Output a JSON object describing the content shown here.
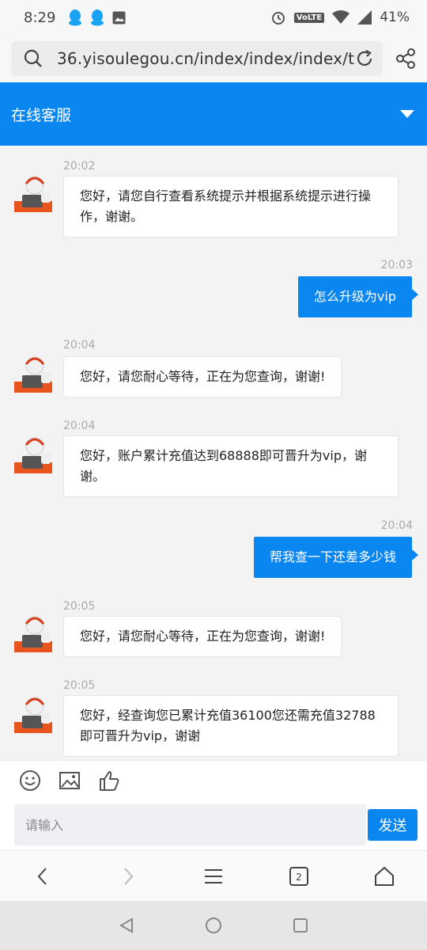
{
  "status": {
    "time": "8:29",
    "network": "VoLTE",
    "battery": "41%"
  },
  "browser": {
    "url": "36.yisoulegou.cn/index/index/index/t",
    "tab_count": "2"
  },
  "header": {
    "title": "在线客服"
  },
  "messages": [
    {
      "side": "in",
      "time": "20:02",
      "text": "您好，请您自行查看系统提示并根据系统提示进行操作，谢谢。"
    },
    {
      "side": "out",
      "time": "20:03",
      "text": "怎么升级为vip"
    },
    {
      "side": "in",
      "time": "20:04",
      "text": "您好，请您耐心等待，正在为您查询，谢谢!"
    },
    {
      "side": "in",
      "time": "20:04",
      "text": "您好，账户累计充值达到68888即可晋升为vip，谢谢。"
    },
    {
      "side": "out",
      "time": "20:04",
      "text": "帮我查一下还差多少钱"
    },
    {
      "side": "in",
      "time": "20:05",
      "text": "您好，请您耐心等待，正在为您查询，谢谢!"
    },
    {
      "side": "in",
      "time": "20:05",
      "text": "您好，经查询您已累计充值36100您还需充值32788即可晋升为vip，谢谢"
    }
  ],
  "composer": {
    "placeholder": "请输入",
    "send_label": "发送"
  },
  "colors": {
    "accent": "#0a86f0"
  }
}
